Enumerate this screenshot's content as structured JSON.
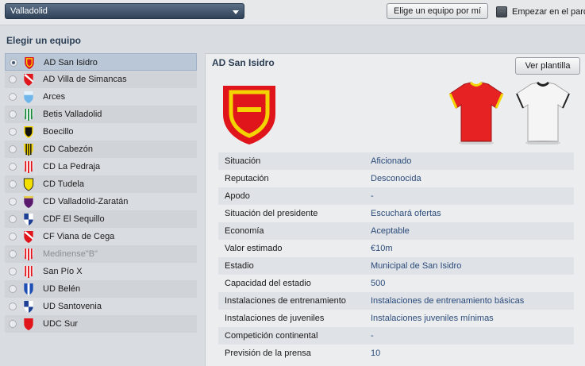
{
  "topbar": {
    "region_value": "Valladolid",
    "pick_button": "Elige un equipo por mí",
    "start_label": "Empezar en el parc"
  },
  "left": {
    "title": "Elegir un equipo",
    "teams": [
      {
        "name": "AD San Isidro",
        "selected": true,
        "icon": "shield-red-yellow-icon"
      },
      {
        "name": "AD Villa de Simancas",
        "icon": "shield-red-white-sash-icon"
      },
      {
        "name": "Arces",
        "icon": "shield-lightblue-icon"
      },
      {
        "name": "Betis Valladolid",
        "icon": "shield-green-stripes-icon"
      },
      {
        "name": "Boecillo",
        "icon": "shield-black-yellow-icon"
      },
      {
        "name": "CD Cabezón",
        "icon": "shield-yellow-black-stripes-icon"
      },
      {
        "name": "CD La Pedraja",
        "icon": "shield-red-white-stripes-icon"
      },
      {
        "name": "CD Tudela",
        "icon": "shield-yellow-icon"
      },
      {
        "name": "CD Valladolid-Zaratán",
        "icon": "shield-purple-icon"
      },
      {
        "name": "CDF El Sequillo",
        "icon": "shield-blue-white-quarters-icon"
      },
      {
        "name": "CF Viana de Cega",
        "icon": "shield-red-white-sash-icon"
      },
      {
        "name": "Medinense\"B\"",
        "muted": true,
        "icon": "shield-red-white-stripes-icon"
      },
      {
        "name": "San Pío X",
        "icon": "shield-red-white-stripes-icon"
      },
      {
        "name": "UD Belén",
        "icon": "shield-blue-white-icon"
      },
      {
        "name": "UD Santovenia",
        "icon": "shield-blue-white-quarters-icon"
      },
      {
        "name": "UDC Sur",
        "icon": "shield-red-icon"
      }
    ]
  },
  "detail": {
    "title": "AD San Isidro",
    "squad_button": "Ver plantilla",
    "rows": [
      {
        "label": "Situación",
        "value": "Aficionado"
      },
      {
        "label": "Reputación",
        "value": "Desconocida"
      },
      {
        "label": "Apodo",
        "value": "-"
      },
      {
        "label": "Situación del presidente",
        "value": "Escuchará ofertas"
      },
      {
        "label": "Economía",
        "value": "Aceptable"
      },
      {
        "label": "Valor estimado",
        "value": "€10m"
      },
      {
        "label": "Estadio",
        "value": "Municipal de San Isidro"
      },
      {
        "label": "Capacidad del estadio",
        "value": "500"
      },
      {
        "label": "Instalaciones de entrenamiento",
        "value": "Instalaciones de entrenamiento básicas"
      },
      {
        "label": "Instalaciones de juveniles",
        "value": "Instalaciones juveniles mínimas"
      },
      {
        "label": "Competición continental",
        "value": "-"
      },
      {
        "label": "Previsión de la prensa",
        "value": "10"
      }
    ]
  },
  "colors": {
    "accent_blue": "#2b4b7a",
    "crest_red": "#e0141b",
    "crest_yellow": "#f4d400",
    "home_kit_red": "#e62222",
    "away_kit_white": "#f5f5f5"
  }
}
